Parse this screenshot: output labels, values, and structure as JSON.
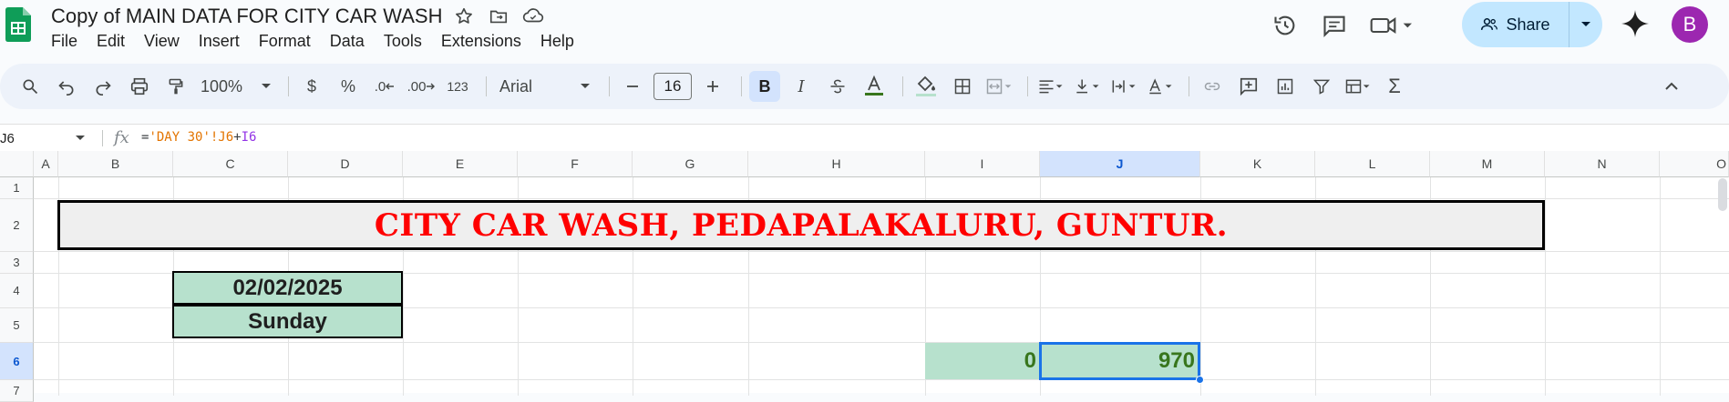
{
  "document": {
    "title": "Copy of MAIN DATA FOR CITY CAR WASH"
  },
  "menu": [
    "File",
    "Edit",
    "View",
    "Insert",
    "Format",
    "Data",
    "Tools",
    "Extensions",
    "Help"
  ],
  "header": {
    "share_label": "Share",
    "avatar_letter": "B"
  },
  "toolbar": {
    "zoom": "100%",
    "currency": "$",
    "percent": "%",
    "decrease_decimal": ".0",
    "increase_decimal": ".00",
    "number_format": "123",
    "font": "Arial",
    "font_size": "16",
    "bold": "B",
    "italic": "I",
    "sum": "Σ"
  },
  "formula_bar": {
    "cell_ref": "J6",
    "fx": "fx",
    "formula_eq": "=",
    "formula_ref": "'DAY 30'!J6",
    "formula_plus": "+",
    "formula_cell": "I6"
  },
  "grid": {
    "columns": [
      "A",
      "B",
      "C",
      "D",
      "E",
      "F",
      "G",
      "H",
      "I",
      "J",
      "K",
      "L",
      "M",
      "N",
      "O"
    ],
    "rows": [
      "1",
      "2",
      "3",
      "4",
      "5",
      "6",
      "7"
    ],
    "selected_column": "J",
    "selected_row": "6"
  },
  "cells": {
    "banner": "CITY CAR WASH, PEDAPALAKALURU, GUNTUR.",
    "date": "02/02/2025",
    "day": "Sunday",
    "i6": "0",
    "j6": "970"
  },
  "colors": {
    "accent": "#1a73e8",
    "banner_text": "#ff0000",
    "cell_fill": "#b7e1cd",
    "value_text": "#38761d",
    "share_bg": "#c2e7ff"
  }
}
